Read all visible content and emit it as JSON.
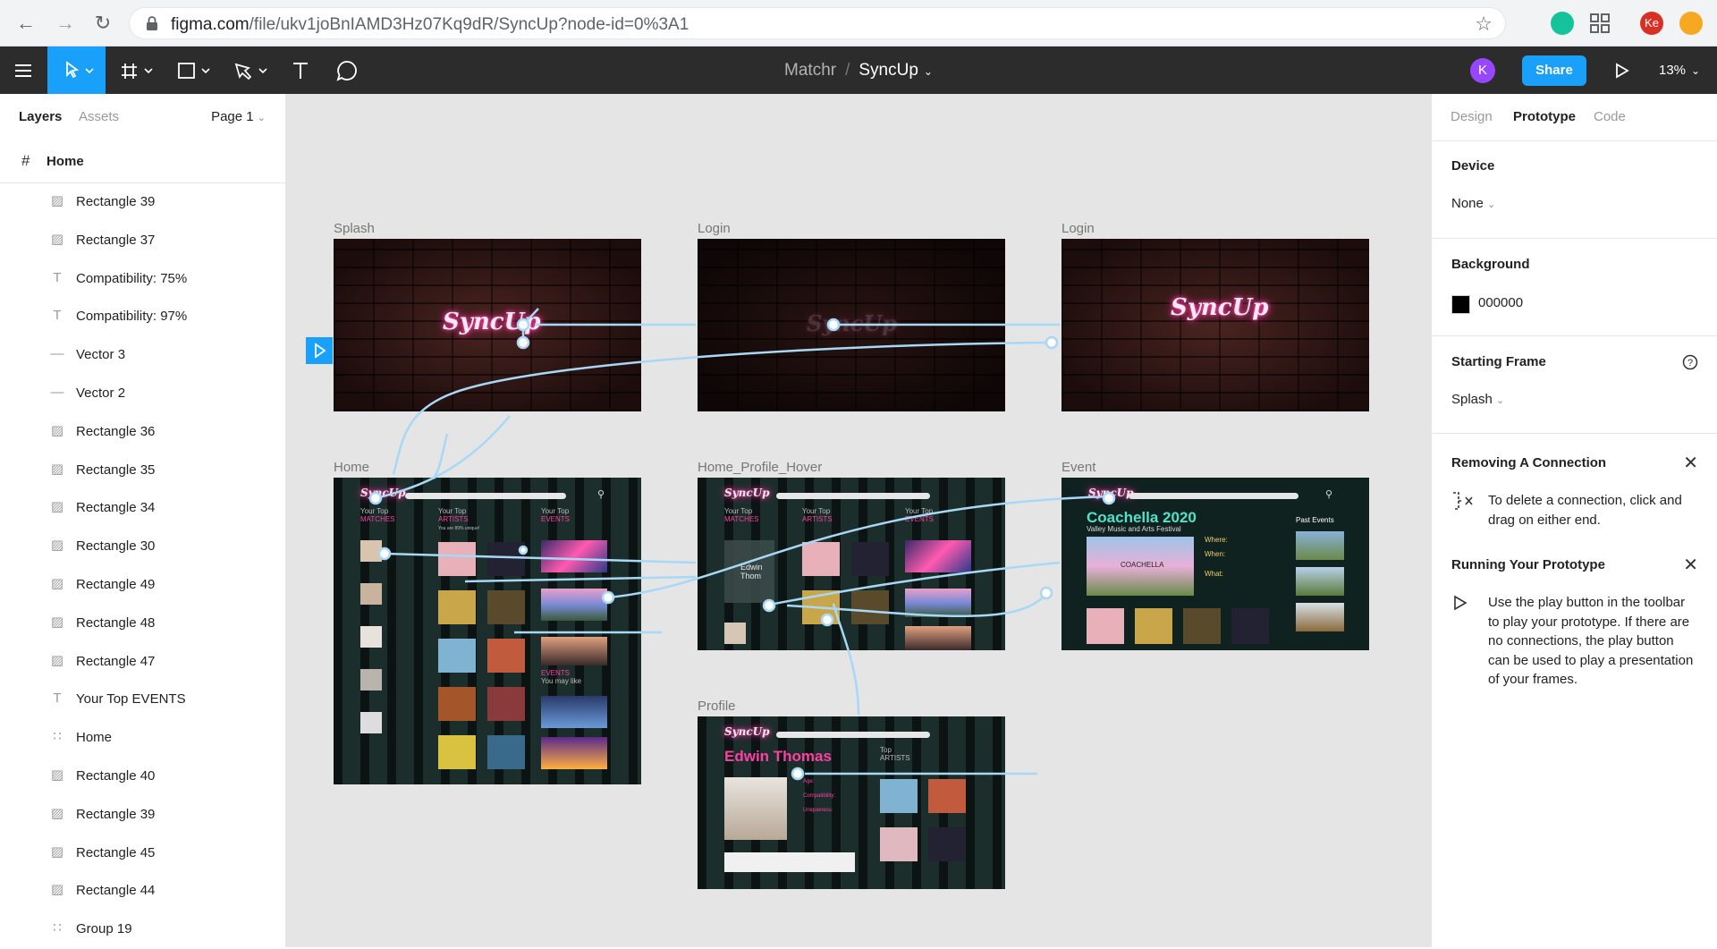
{
  "browser": {
    "url_host": "figma.com",
    "url_path": "/file/ukv1joBnIAMD3Hz07Kq9dR/SyncUp?node-id=0%3A1",
    "profile_initials": "Ke",
    "icons": [
      "back-icon",
      "forward-icon",
      "reload-icon",
      "lock-icon",
      "star-icon",
      "grammarly-icon",
      "apps-icon"
    ]
  },
  "toolbar": {
    "project": "Matchr",
    "separator": "/",
    "file": "SyncUp",
    "user_initial": "K",
    "share_label": "Share",
    "zoom": "13%",
    "accent": "#18a0fb"
  },
  "left_panel": {
    "tab_layers": "Layers",
    "tab_assets": "Assets",
    "page": "Page 1",
    "home_frame": "Home",
    "layers": [
      {
        "name": "Rectangle 39",
        "type": "image"
      },
      {
        "name": "Rectangle 37",
        "type": "image"
      },
      {
        "name": "Compatibility: 75%",
        "type": "text"
      },
      {
        "name": "Compatibility: 97%",
        "type": "text"
      },
      {
        "name": "Vector 3",
        "type": "vector"
      },
      {
        "name": "Vector 2",
        "type": "vector"
      },
      {
        "name": "Rectangle 36",
        "type": "image"
      },
      {
        "name": "Rectangle 35",
        "type": "image"
      },
      {
        "name": "Rectangle 34",
        "type": "image"
      },
      {
        "name": "Rectangle 30",
        "type": "image"
      },
      {
        "name": "Rectangle 49",
        "type": "image"
      },
      {
        "name": "Rectangle 48",
        "type": "image"
      },
      {
        "name": "Rectangle 47",
        "type": "image"
      },
      {
        "name": "Your Top EVENTS",
        "type": "text"
      },
      {
        "name": "Home",
        "type": "group"
      },
      {
        "name": "Rectangle 40",
        "type": "image"
      },
      {
        "name": "Rectangle 39",
        "type": "image"
      },
      {
        "name": "Rectangle 45",
        "type": "image"
      },
      {
        "name": "Rectangle 44",
        "type": "image"
      },
      {
        "name": "Group 19",
        "type": "group"
      }
    ]
  },
  "canvas": {
    "frames": {
      "splash": "Splash",
      "login1": "Login",
      "login2": "Login",
      "home": "Home",
      "hover": "Home_Profile_Hover",
      "event": "Event",
      "profile": "Profile"
    },
    "brand": "SyncUp",
    "home": {
      "matches_top": "Your Top",
      "matches": "MATCHES",
      "artists_top": "Your Top",
      "artists": "ARTISTS",
      "artists_sub": "You are 89% unique!",
      "events_top": "Your Top",
      "events": "EVENTS",
      "events2": "EVENTS",
      "events2_sub": "You may like"
    },
    "hover": {
      "name_first": "Edwin",
      "name_last": "Thom"
    },
    "event": {
      "title": "Coachella 2020",
      "subtitle": "Valley Music and Arts Festival",
      "past_events": "Past Events",
      "where": "Where:",
      "when": "When:",
      "what": "What:",
      "poster": "COACHELLA"
    },
    "profile": {
      "name": "Edwin Thomas",
      "top": "Top",
      "artists": "ARTISTS",
      "age": "Age:",
      "compatibility": "Compatibility:",
      "uniqueness": "Uniqueness:"
    }
  },
  "right_panel": {
    "tab_design": "Design",
    "tab_prototype": "Prototype",
    "tab_code": "Code",
    "device_h": "Device",
    "device_v": "None",
    "background_h": "Background",
    "background_v": "000000",
    "background_color": "#000000",
    "starting_frame_h": "Starting Frame",
    "starting_frame_v": "Splash",
    "removing_h": "Removing A Connection",
    "removing_p": "To delete a connection, click and drag on either end.",
    "running_h": "Running Your Prototype",
    "running_p": "Use the play button in the toolbar to play your prototype. If there are no connections, the play button can be used to play a presentation of your frames."
  }
}
